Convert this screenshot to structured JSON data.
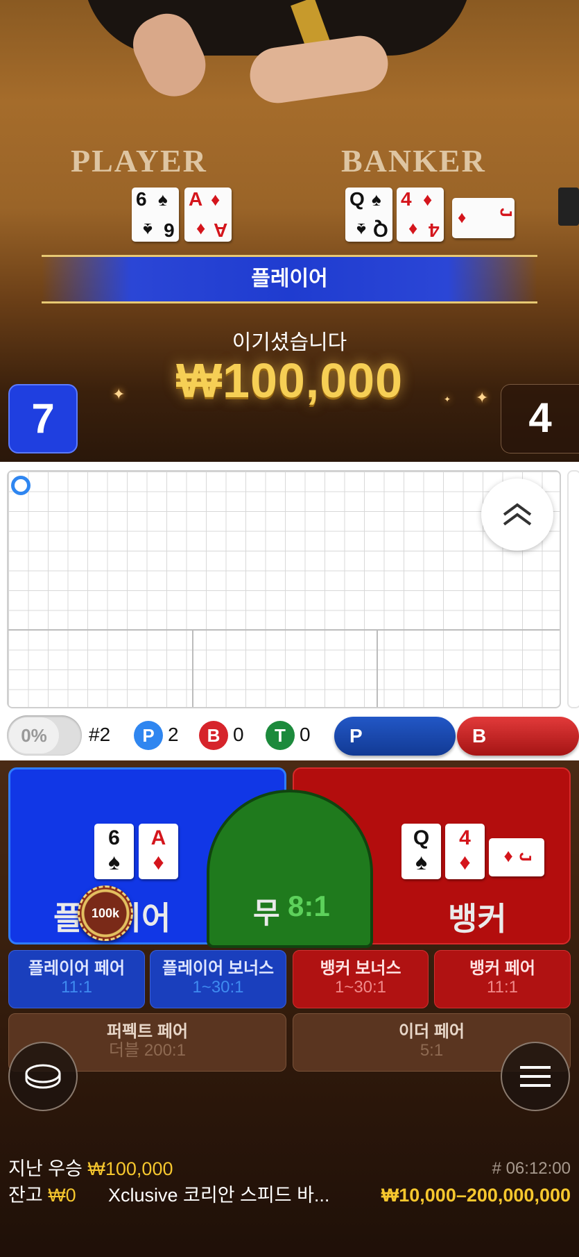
{
  "table": {
    "player_label": "PLAYER",
    "banker_label": "BANKER",
    "player_cards": [
      {
        "rank": "6",
        "suit": "♠",
        "color": "#111111"
      },
      {
        "rank": "A",
        "suit": "♦",
        "color": "#d4151c"
      }
    ],
    "banker_cards": [
      {
        "rank": "Q",
        "suit": "♠",
        "color": "#111111"
      },
      {
        "rank": "4",
        "suit": "♦",
        "color": "#d4151c"
      },
      {
        "rank": "J",
        "suit": "♦",
        "color": "#d4151c"
      }
    ]
  },
  "result": {
    "winner": "플레이어",
    "message": "이기셨습니다",
    "amount": "₩100,000",
    "player_score": "7",
    "banker_score": "4"
  },
  "roadmap": {
    "first_result_color": "#2f86f0",
    "expand_icon": "double-chevron-up-icon"
  },
  "stats": {
    "percent_toggle": "0%",
    "round": "#2",
    "player_letter": "P",
    "player_count": "2",
    "banker_letter": "B",
    "banker_count": "0",
    "tie_letter": "T",
    "tie_count": "0",
    "predict_player": "P",
    "predict_banker": "B",
    "colors": {
      "player": "#2f86f0",
      "banker": "#d6242b",
      "tie": "#1c8a3c"
    }
  },
  "bets": {
    "player": {
      "label": "플레이어",
      "cards": [
        {
          "rank": "6",
          "suit": "♠",
          "color": "#111111"
        },
        {
          "rank": "A",
          "suit": "♦",
          "color": "#d4151c"
        }
      ]
    },
    "tie": {
      "label": "무",
      "odds": "8:1"
    },
    "banker": {
      "label": "뱅커",
      "cards": [
        {
          "rank": "Q",
          "suit": "♠",
          "color": "#111111"
        },
        {
          "rank": "4",
          "suit": "♦",
          "color": "#d4151c"
        },
        {
          "rank": "J",
          "suit": "♦",
          "color": "#d4151c"
        }
      ]
    },
    "chip": "100k",
    "side_bets": [
      {
        "title": "플레이어 페어",
        "odds": "11:1"
      },
      {
        "title": "플레이어 보너스",
        "odds": "1~30:1"
      },
      {
        "title": "뱅커 보너스",
        "odds": "1~30:1"
      },
      {
        "title": "뱅커 페어",
        "odds": "11:1"
      },
      {
        "title": "퍼펙트 페어",
        "odds": "더블 200:1"
      },
      {
        "title": "이더 페어",
        "odds": "5:1"
      }
    ]
  },
  "footer": {
    "last_win_label": "지난 우승",
    "last_win_value": "₩100,000",
    "round_id": "# 06:12:00",
    "balance_label": "잔고",
    "balance_value": "₩0",
    "table_name": "Xclusive 코리안 스피드 바...",
    "limits": "₩10,000–200,000,000"
  }
}
